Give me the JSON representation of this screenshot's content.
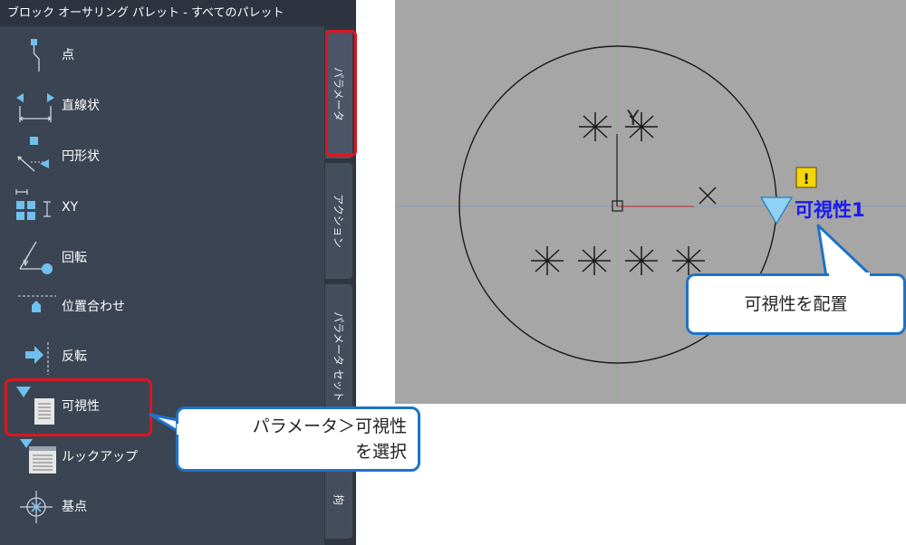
{
  "palette": {
    "title": "ブロック オーサリング パレット - すべてのパレット",
    "tools": [
      {
        "label": "点",
        "icon": "point-parameter-icon"
      },
      {
        "label": "直線状",
        "icon": "linear-parameter-icon"
      },
      {
        "label": "円形状",
        "icon": "polar-parameter-icon"
      },
      {
        "label": "XY",
        "icon": "xy-parameter-icon"
      },
      {
        "label": "回転",
        "icon": "rotation-parameter-icon"
      },
      {
        "label": "位置合わせ",
        "icon": "alignment-parameter-icon"
      },
      {
        "label": "反転",
        "icon": "flip-parameter-icon"
      },
      {
        "label": "可視性",
        "icon": "visibility-parameter-icon"
      },
      {
        "label": "ルックアップ",
        "icon": "lookup-parameter-icon"
      },
      {
        "label": "基点",
        "icon": "basepoint-parameter-icon"
      }
    ],
    "tabs": [
      {
        "label": "パラメータ",
        "active": true
      },
      {
        "label": "アクション",
        "active": false
      },
      {
        "label": "パラメータ セット",
        "active": false
      },
      {
        "label": "拘",
        "active": false
      }
    ]
  },
  "drawing": {
    "parameter_label": "可視性1",
    "xy_letter": "Y",
    "axis_mark": "X",
    "alert_glyph": "!"
  },
  "callouts": {
    "select_line1": "パラメータ＞可視性",
    "select_line2": "を選択",
    "place": "可視性を配置"
  },
  "colors": {
    "palette_bg": "#3b4453",
    "drawing_bg": "#a6a6a6",
    "highlight": "#e0141e",
    "callout_border": "#1e73c8",
    "icon_blue": "#6fc0ee",
    "parameter_blue": "#1a1aee"
  }
}
